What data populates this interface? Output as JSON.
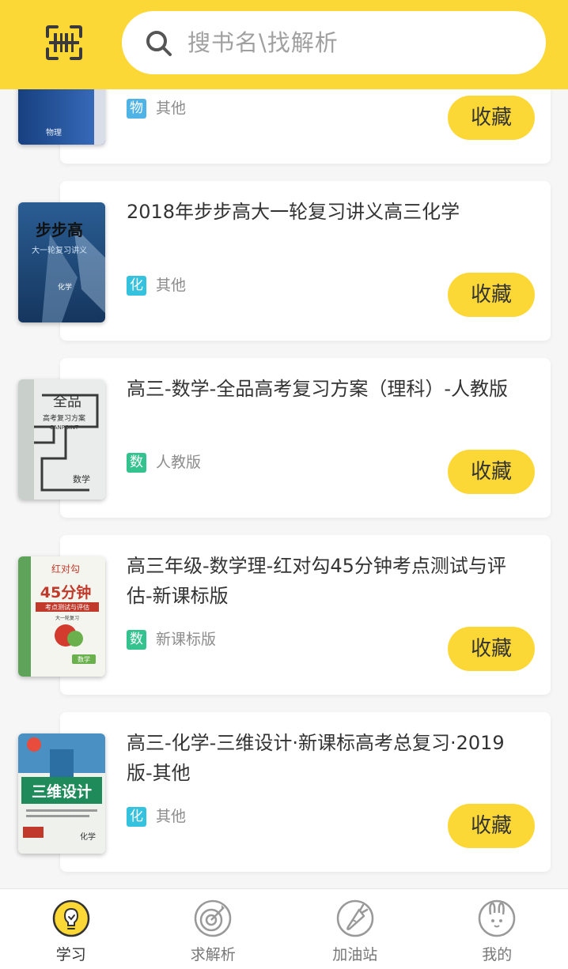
{
  "search": {
    "placeholder": "搜书名\\找解析"
  },
  "books": [
    {
      "title": "",
      "subject": "物",
      "subject_color": "#4fb3e6",
      "edition": "其他",
      "button": "收藏"
    },
    {
      "title": "2018年步步高大一轮复习讲义高三化学",
      "subject": "化",
      "subject_color": "#35c2df",
      "edition": "其他",
      "button": "收藏"
    },
    {
      "title": "高三-数学-全品高考复习方案（理科）-人教版",
      "subject": "数",
      "subject_color": "#34c38f",
      "edition": "人教版",
      "button": "收藏"
    },
    {
      "title": "高三年级-数学理-红对勾45分钟考点测试与评估-新课标版",
      "subject": "数",
      "subject_color": "#34c38f",
      "edition": "新课标版",
      "button": "收藏"
    },
    {
      "title": "高三-化学-三维设计·新课标高考总复习·2019版-其他",
      "subject": "化",
      "subject_color": "#35c2df",
      "edition": "其他",
      "button": "收藏"
    }
  ],
  "covers": {
    "c0": {
      "text": "物理"
    },
    "c1": {
      "brand": "步步高",
      "sub": "大一轮复习讲义",
      "subject": "化学"
    },
    "c2": {
      "brand": "全品",
      "sub": "高考复习方案",
      "latin": "CANPOINT",
      "subject": "数学"
    },
    "c3": {
      "brand": "红对勾",
      "big": "45分钟",
      "sub": "考点测试与评估",
      "sub2": "大一轮复习",
      "subject": "数学"
    },
    "c4": {
      "big": "三维设计",
      "subject": "化学"
    }
  },
  "tabs": [
    {
      "label": "学习",
      "icon": "bulb-icon",
      "active": true
    },
    {
      "label": "求解析",
      "icon": "target-icon",
      "active": false
    },
    {
      "label": "加油站",
      "icon": "carrot-icon",
      "active": false
    },
    {
      "label": "我的",
      "icon": "rabbit-icon",
      "active": false
    }
  ],
  "colors": {
    "accent": "#fcd837",
    "background": "#f6f6f6",
    "text": "#333333"
  }
}
